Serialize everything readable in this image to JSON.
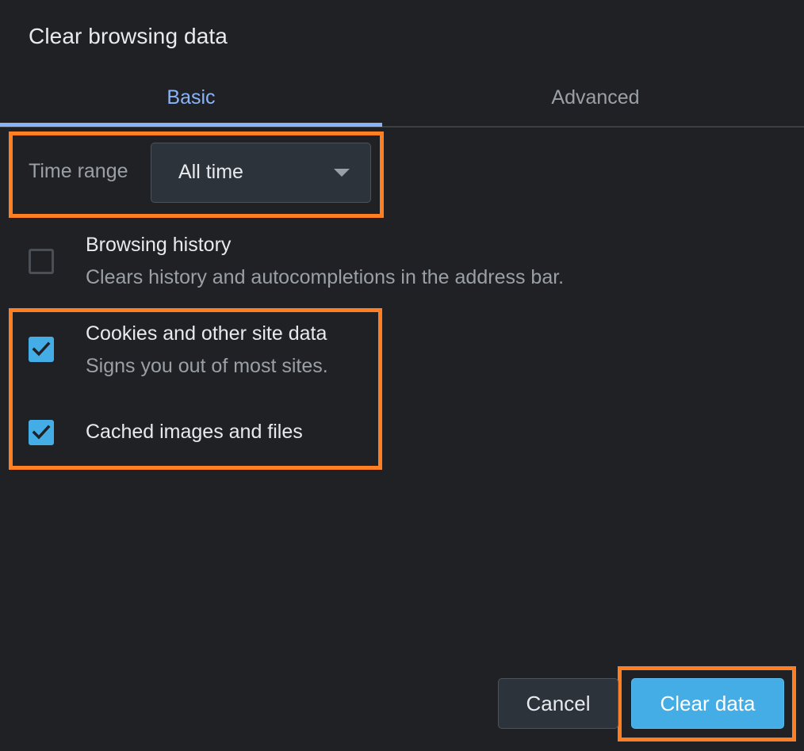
{
  "dialog": {
    "title": "Clear browsing data"
  },
  "tabs": [
    {
      "label": "Basic",
      "selected": true
    },
    {
      "label": "Advanced",
      "selected": false
    }
  ],
  "time_range": {
    "label": "Time range",
    "selected_value": "All time"
  },
  "items": [
    {
      "title": "Browsing history",
      "subtitle": "Clears history and autocompletions in the address bar.",
      "checked": false
    },
    {
      "title": "Cookies and other site data",
      "subtitle": "Signs you out of most sites.",
      "checked": true
    },
    {
      "title": "Cached images and files",
      "subtitle": "",
      "checked": true
    }
  ],
  "buttons": {
    "cancel_label": "Cancel",
    "clear_label": "Clear data"
  },
  "colors": {
    "background": "#202124",
    "accent": "#8ab4f8",
    "primary_button": "#45ade6",
    "highlight": "#ff7f22"
  }
}
